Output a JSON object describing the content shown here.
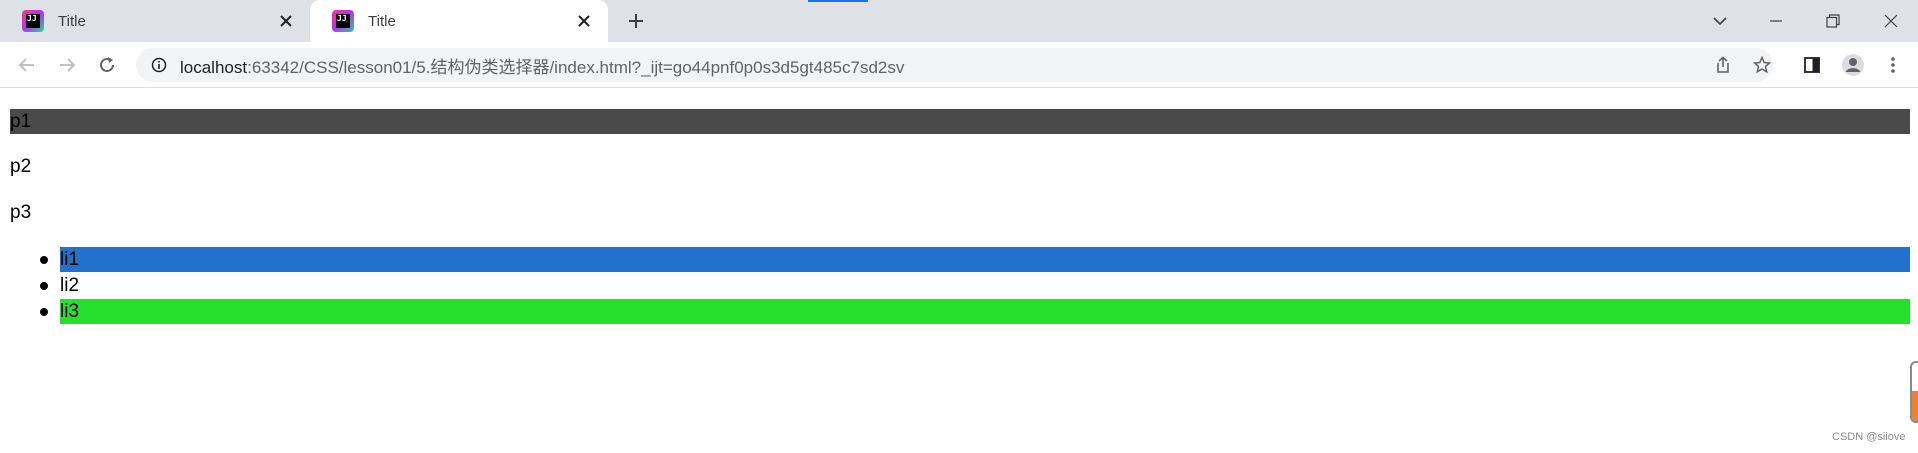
{
  "tabs": [
    {
      "title": "Title",
      "favicon": "jetbrains-icon",
      "active": false
    },
    {
      "title": "Title",
      "favicon": "jetbrains-icon",
      "active": true
    }
  ],
  "address_bar": {
    "host": "localhost",
    "path": ":63342/CSS/lesson01/5.结构伪类选择器/index.html?_ijt=go44pnf0p0s3d5gt485c7sd2sv"
  },
  "page": {
    "paragraphs": [
      "p1",
      "p2",
      "p3"
    ],
    "list_items": [
      "li1",
      "li2",
      "li3"
    ]
  },
  "colors": {
    "p1_background": "#4a4a4a",
    "li1_background": "#2271cc",
    "li3_background": "#27e02b"
  },
  "watermark": "CSDN @siiove"
}
